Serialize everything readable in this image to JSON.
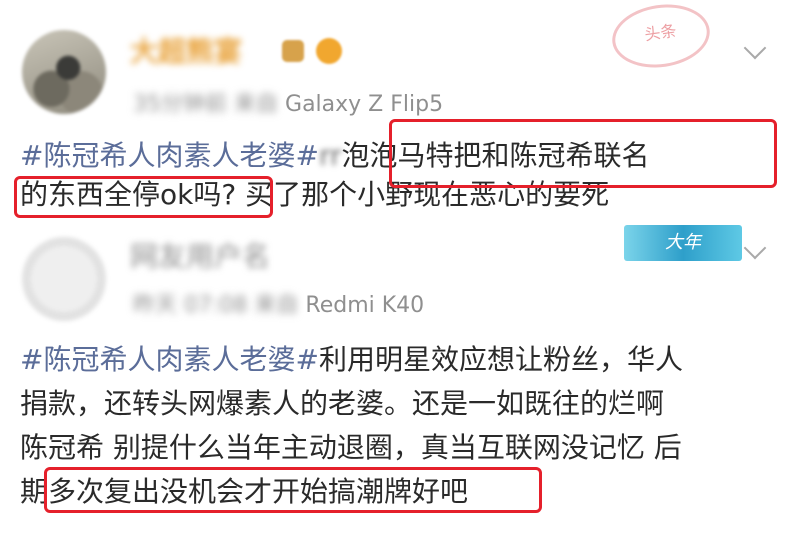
{
  "posts": [
    {
      "username": "大超熊宴",
      "meta_time": "35分钟前",
      "meta_from": "来自",
      "device": "Galaxy Z Flip5",
      "stamp_label": "头条",
      "text": {
        "topic": "#陈冠希人肉素人老婆#",
        "smudge": "rr",
        "line1_rest": "泡泡马特把和陈冠希联名",
        "line2_hl": "的东西全停ok吗?",
        "line2_rest": "买了那个小野现在恶心的要死"
      }
    },
    {
      "username": "网友用户名",
      "meta_time": "昨天 07:08",
      "meta_from": "来自",
      "device": "Redmi K40",
      "stamp_label": "大年",
      "text": {
        "line1_topic": "#陈冠希人肉素人老婆#",
        "line1_rest": "利用明星效应想让粉丝，华人",
        "line2": "捐款，还转头网爆素人的老婆。还是一如既往的烂啊",
        "line3": "陈冠希 别提什么当年主动退圈，真当互联网没记忆 后",
        "line4_start": "期",
        "line4_hl": "多次复出没机会才开始搞潮牌好吧"
      }
    }
  ],
  "icons": [
    "avatar",
    "vip-badge-icon",
    "emoji-icon",
    "chevron-down-icon"
  ],
  "colors": {
    "highlight_box": "#e5202b",
    "topic": "#5b6d99",
    "username": "#e8a23a"
  }
}
